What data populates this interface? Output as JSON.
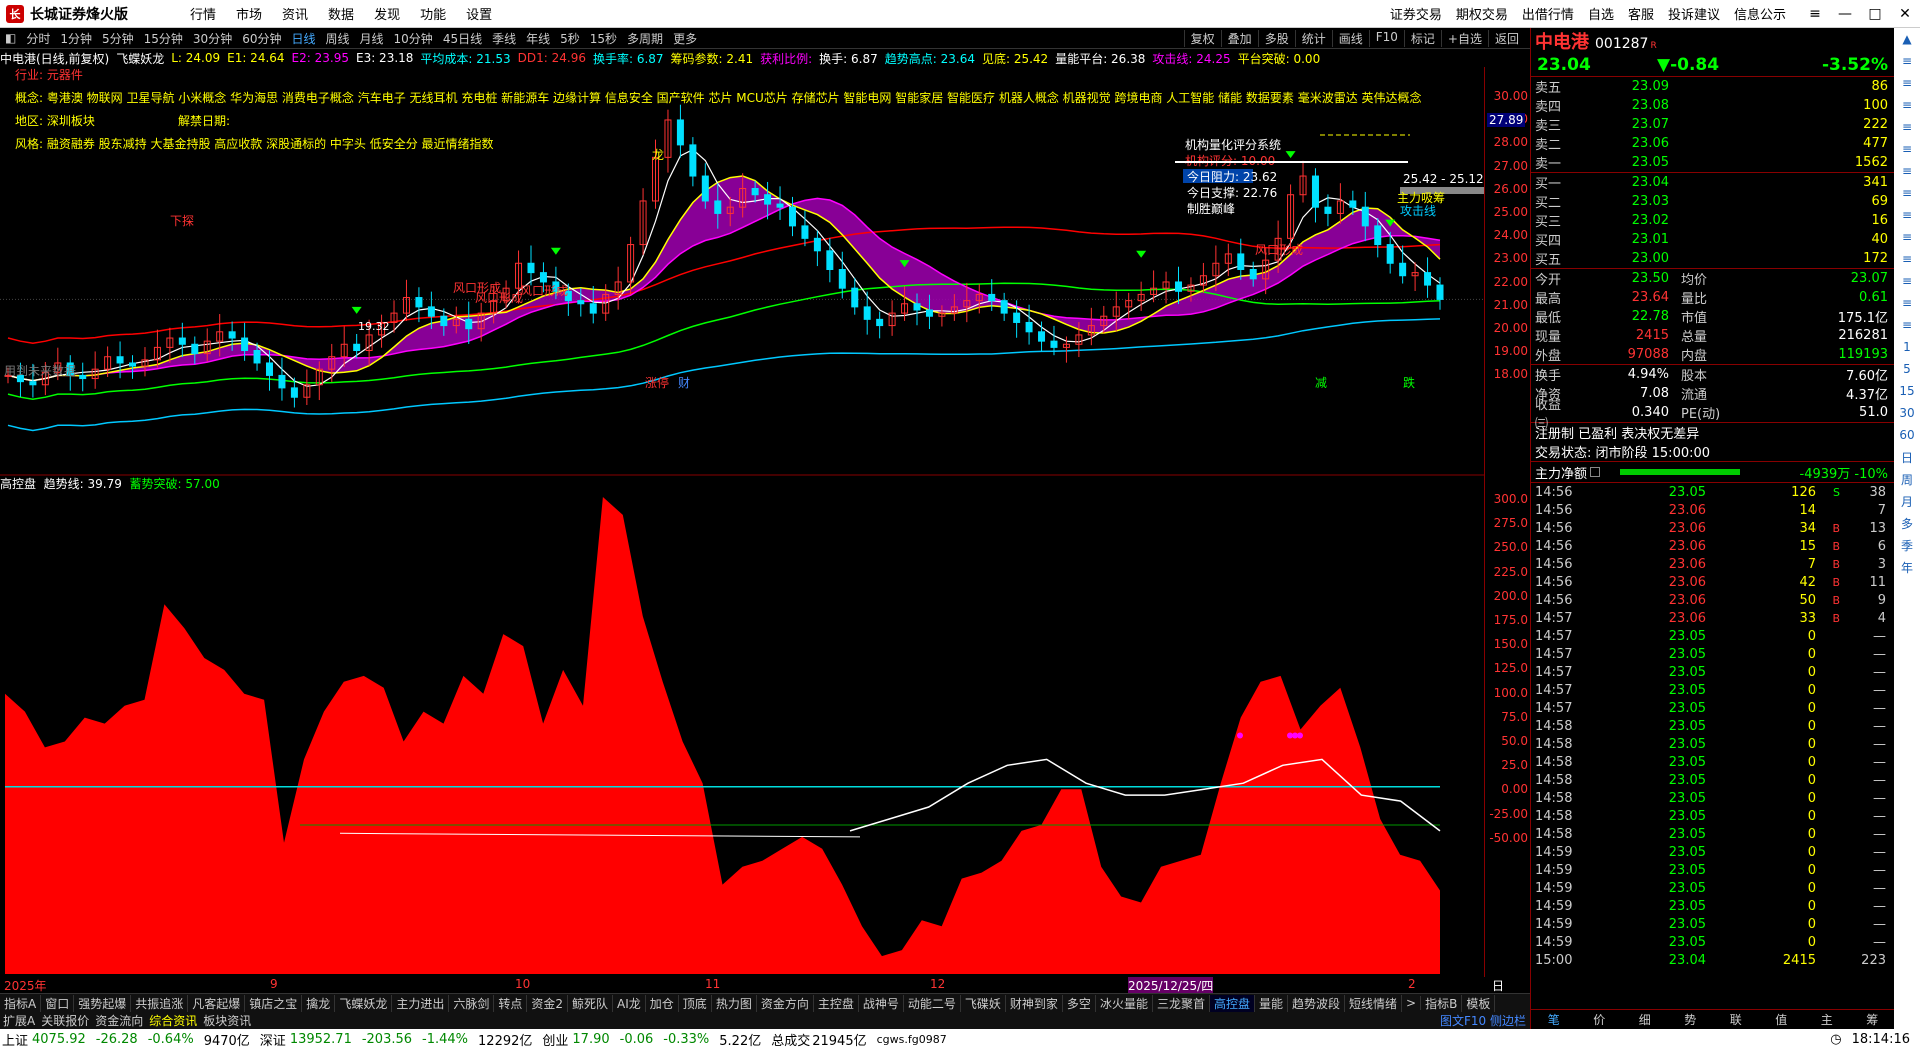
{
  "app": {
    "title": "长城证券烽火版",
    "menu": [
      "行情",
      "市场",
      "资讯",
      "数据",
      "发现",
      "功能",
      "设置"
    ],
    "right_menu": [
      "证券交易",
      "期权交易",
      "出借行情",
      "自选",
      "客服",
      "投诉建议",
      "信息公示"
    ]
  },
  "periods": [
    "分时",
    "1分钟",
    "5分钟",
    "15分钟",
    "30分钟",
    "60分钟",
    "日线",
    "周线",
    "月线",
    "10分钟",
    "45日线",
    "季线",
    "年线",
    "5秒",
    "15秒",
    "多周期",
    "更多"
  ],
  "period_selected": "日线",
  "toolbar_right": [
    "复权",
    "叠加",
    "多股",
    "统计",
    "画线",
    "F10",
    "标记",
    "+自选",
    "返回"
  ],
  "info": {
    "name": "中电港(日线,前复权)",
    "ind": "飞蝶妖龙",
    "L": "L: 24.09",
    "E1": "E1: 24.64",
    "E2": "E2: 23.95",
    "E3": "E3: 23.18",
    "avg": "平均成本: 21.53",
    "dd": "DD1: 24.96",
    "hs": "换手率: 6.87",
    "cm": "筹码参数: 2.41",
    "hl": "获利比例:",
    "hs2": "换手: 6.87",
    "qs": "趋势高点: 23.64",
    "jd": "见底: 25.42",
    "pt": "量能平台: 26.38",
    "gj": "攻击线: 24.25",
    "tp": "平台突破: 0.00"
  },
  "notes": {
    "industry": "行业: 元器件",
    "concept": "概念: 粤港澳 物联网 卫星导航 小米概念 华为海思 消费电子概念 汽车电子 无线耳机 充电桩 新能源车 边缘计算 信息安全 国产软件 芯片 MCU芯片 存储芯片 智能电网 智能家居 智能医疗 机器人概念 机器视觉 跨境电商 人工智能 储能 数据要素 毫米波雷达 英伟达概念",
    "region": "地区: 深圳板块",
    "unlock": "解禁日期:",
    "style": "风格: 融资融券 股东减持 大基金持股 高应收款 深股通标的 中字头 低安全分 最近情绪指数"
  },
  "quant": {
    "title": "机构量化评分系统",
    "score": "机构评分: 10.00",
    "resist": "今日阻力: 23.62",
    "support": "今日支撑: 22.76",
    "verdict": "制胜巅峰"
  },
  "labels": {
    "range": "25.42 - 25.12",
    "main": "主力吸筹",
    "attack": "攻击线",
    "low": "19.32",
    "down": "下探",
    "wind1": "风口形成",
    "wind2": "风口形成",
    "wind3": "风口形成",
    "wind4": "风口形成",
    "future": "用到未来数据",
    "tag1": "涨停",
    "tag2": "财",
    "tag3": "减",
    "tag4": "跌",
    "price_box": "27.89",
    "dragon": "龙"
  },
  "lower_ind": {
    "name": "高控盘",
    "trend": "趋势线: 39.79",
    "break": "蓄势突破: 57.00"
  },
  "xaxis": [
    "2025年",
    "9",
    "10",
    "11",
    "12",
    "2025/12/25/四",
    "2"
  ],
  "xaxis_right": "日线",
  "bottom_tabs": [
    "指标A",
    "窗口",
    "强势起爆",
    "共振追涨",
    "凡客起爆",
    "镇店之宝",
    "擒龙",
    "飞蝶妖龙",
    "主力进出",
    "六脉剑",
    "转点",
    "资金2",
    "鲸死队",
    "AI龙",
    "加仓",
    "顶底",
    "热力图",
    "资金方向",
    "主控盘",
    "战神号",
    "动能二号",
    "飞碟妖",
    "财神到家",
    "多空",
    "冰火量能",
    "三龙聚首",
    "高控盘",
    "量能",
    "趋势波段",
    "短线情绪",
    ">",
    "指标B",
    "模板"
  ],
  "bottom_tab_selected": "高控盘",
  "bottom_tabs2": [
    "扩展A",
    "关联报价",
    "资金流向",
    "综合资讯",
    "板块资讯"
  ],
  "f10": "图文F10 侧边栏",
  "status": {
    "sh": "上证",
    "sh_v": "4075.92",
    "sh_c": "-26.28",
    "sh_p": "-0.64%",
    "sh_a": "9470亿",
    "sz": "深证",
    "sz_v": "13952.71",
    "sz_c": "-203.56",
    "sz_p": "-1.44%",
    "sz_a": "12292亿",
    "cy": "创业",
    "cy_v": "17.90",
    "cy_c": "-0.06",
    "cy_p": "-0.33%",
    "cy_a": "5.22亿",
    "total": "总成交",
    "total_v": "21945亿",
    "server": "cgws.fg0987",
    "time": "18:14:16"
  },
  "quote": {
    "name": "中电港",
    "code": "001287",
    "price": "23.04",
    "change": "▼-0.84",
    "pct": "-3.52%",
    "asks": [
      [
        "卖五",
        "23.09",
        "86"
      ],
      [
        "卖四",
        "23.08",
        "100"
      ],
      [
        "卖三",
        "23.07",
        "222"
      ],
      [
        "卖二",
        "23.06",
        "477"
      ],
      [
        "卖一",
        "23.05",
        "1562"
      ]
    ],
    "bids": [
      [
        "买一",
        "23.04",
        "341"
      ],
      [
        "买二",
        "23.03",
        "69"
      ],
      [
        "买三",
        "23.02",
        "16"
      ],
      [
        "买四",
        "23.01",
        "40"
      ],
      [
        "买五",
        "23.00",
        "172"
      ]
    ],
    "stats": [
      [
        "今开",
        "23.50",
        "均价",
        "23.07"
      ],
      [
        "最高",
        "23.64",
        "量比",
        "0.61"
      ],
      [
        "最低",
        "22.78",
        "市值",
        "175.1亿"
      ],
      [
        "现量",
        "2415",
        "总量",
        "216281"
      ],
      [
        "外盘",
        "97088",
        "内盘",
        "119193"
      ]
    ],
    "stats2": [
      [
        "换手",
        "4.94%",
        "股本",
        "7.60亿"
      ],
      [
        "净资",
        "7.08",
        "流通",
        "4.37亿"
      ],
      [
        "收益㈢",
        "0.340",
        "PE(动)",
        "51.0"
      ]
    ],
    "reg": "注册制  已盈利  表决权无差异",
    "trade": "交易状态: 闭市阶段 15:00:00",
    "flow_label": "主力净额",
    "flow_val": "-4939万 -10%",
    "ticks": [
      [
        "14:56",
        "23.05",
        "126",
        "S",
        "38"
      ],
      [
        "14:56",
        "23.06",
        "14",
        "",
        "7"
      ],
      [
        "14:56",
        "23.06",
        "34",
        "B",
        "13"
      ],
      [
        "14:56",
        "23.06",
        "15",
        "B",
        "6"
      ],
      [
        "14:56",
        "23.06",
        "7",
        "B",
        "3"
      ],
      [
        "14:56",
        "23.06",
        "42",
        "B",
        "11"
      ],
      [
        "14:56",
        "23.06",
        "50",
        "B",
        "9"
      ],
      [
        "14:57",
        "23.06",
        "33",
        "B",
        "4"
      ],
      [
        "14:57",
        "23.05",
        "0",
        "",
        "—"
      ],
      [
        "14:57",
        "23.05",
        "0",
        "",
        "—"
      ],
      [
        "14:57",
        "23.05",
        "0",
        "",
        "—"
      ],
      [
        "14:57",
        "23.05",
        "0",
        "",
        "—"
      ],
      [
        "14:57",
        "23.05",
        "0",
        "",
        "—"
      ],
      [
        "14:58",
        "23.05",
        "0",
        "",
        "—"
      ],
      [
        "14:58",
        "23.05",
        "0",
        "",
        "—"
      ],
      [
        "14:58",
        "23.05",
        "0",
        "",
        "—"
      ],
      [
        "14:58",
        "23.05",
        "0",
        "",
        "—"
      ],
      [
        "14:58",
        "23.05",
        "0",
        "",
        "—"
      ],
      [
        "14:58",
        "23.05",
        "0",
        "",
        "—"
      ],
      [
        "14:58",
        "23.05",
        "0",
        "",
        "—"
      ],
      [
        "14:59",
        "23.05",
        "0",
        "",
        "—"
      ],
      [
        "14:59",
        "23.05",
        "0",
        "",
        "—"
      ],
      [
        "14:59",
        "23.05",
        "0",
        "",
        "—"
      ],
      [
        "14:59",
        "23.05",
        "0",
        "",
        "—"
      ],
      [
        "14:59",
        "23.05",
        "0",
        "",
        "—"
      ],
      [
        "14:59",
        "23.05",
        "0",
        "",
        "—"
      ],
      [
        "15:00",
        "23.04",
        "2415",
        "",
        "223"
      ]
    ],
    "tabs": [
      "笔",
      "价",
      "细",
      "势",
      "联",
      "值",
      "主",
      "筹"
    ]
  },
  "side": [
    "日",
    "周",
    "月",
    "多",
    "季",
    "年"
  ],
  "side_nums": [
    "1",
    "5",
    "15",
    "30",
    "60"
  ],
  "axis_upper": [
    "30.00",
    "29.00",
    "28.00",
    "27.00",
    "26.00",
    "25.00",
    "24.00",
    "23.00",
    "22.00",
    "21.00",
    "20.00",
    "19.00",
    "18.00"
  ],
  "axis_lower": [
    "300.0",
    "275.0",
    "250.0",
    "225.0",
    "200.0",
    "175.0",
    "150.0",
    "125.0",
    "100.0",
    "75.0",
    "50.0",
    "25.0",
    "0.00",
    "-25.00",
    "-50.00"
  ],
  "colors": {
    "up": "#ff3232",
    "down": "#00e0ff",
    "ma_yellow": "#ffff00",
    "ma_mag": "#ff00ff",
    "ma_green": "#00ff00",
    "ma_cyan": "#00c0ff",
    "ma_red": "#ff0000",
    "fill": "#ff0000",
    "accent": "#44aaff"
  },
  "chart_data": {
    "type": "candlestick+area",
    "upper": {
      "ylim": [
        17.5,
        30.5
      ],
      "close": [
        20.6,
        20.4,
        20.3,
        20.7,
        21.0,
        20.6,
        20.5,
        20.8,
        21.2,
        21.0,
        20.9,
        21.1,
        21.5,
        21.8,
        21.6,
        21.3,
        21.7,
        22.0,
        21.8,
        21.4,
        21.0,
        20.6,
        20.2,
        19.9,
        20.3,
        20.8,
        21.2,
        21.6,
        21.4,
        21.9,
        22.3,
        22.6,
        23.1,
        22.8,
        22.5,
        22.2,
        22.4,
        22.1,
        22.6,
        23.0,
        23.4,
        24.2,
        23.9,
        23.6,
        23.3,
        23.0,
        22.9,
        22.6,
        23.2,
        23.6,
        24.8,
        26.2,
        27.6,
        28.8,
        28.0,
        27.0,
        26.2,
        25.8,
        26.0,
        26.6,
        26.4,
        26.1,
        26.0,
        25.4,
        25.0,
        24.6,
        24.0,
        23.4,
        22.8,
        22.4,
        22.2,
        22.6,
        22.9,
        22.7,
        22.5,
        22.6,
        22.8,
        23.0,
        23.2,
        23.0,
        22.6,
        22.3,
        22.0,
        21.7,
        21.5,
        21.6,
        21.9,
        22.2,
        22.5,
        22.8,
        23.0,
        23.2,
        23.4,
        23.6,
        23.3,
        23.5,
        23.8,
        24.2,
        24.5,
        24.0,
        23.7,
        24.3,
        25.0,
        26.4,
        27.0,
        26.0,
        25.8,
        26.2,
        26.0,
        25.4,
        24.8,
        24.2,
        23.8,
        23.9,
        23.5,
        23.04
      ]
    },
    "lower": {
      "ylim": [
        -100,
        300
      ],
      "values": [
        135,
        120,
        90,
        95,
        115,
        110,
        125,
        130,
        210,
        190,
        165,
        155,
        135,
        130,
        10,
        80,
        120,
        145,
        150,
        140,
        95,
        120,
        110,
        150,
        135,
        185,
        175,
        110,
        155,
        125,
        300,
        285,
        200,
        145,
        95,
        60,
        -25,
        -10,
        -5,
        5,
        15,
        5,
        -25,
        -60,
        -85,
        -80,
        -55,
        -60,
        -20,
        -15,
        -5,
        20,
        25,
        55,
        55,
        -10,
        -35,
        -40,
        -10,
        -5,
        0,
        60,
        115,
        145,
        150,
        105,
        125,
        140,
        90,
        30,
        0,
        -5,
        -30
      ],
      "trend": [
        20,
        30,
        40,
        60,
        75,
        80,
        60,
        50,
        50,
        55,
        60,
        75,
        80,
        50,
        45,
        20
      ],
      "zero_line": 0,
      "ref_line": 57
    }
  }
}
